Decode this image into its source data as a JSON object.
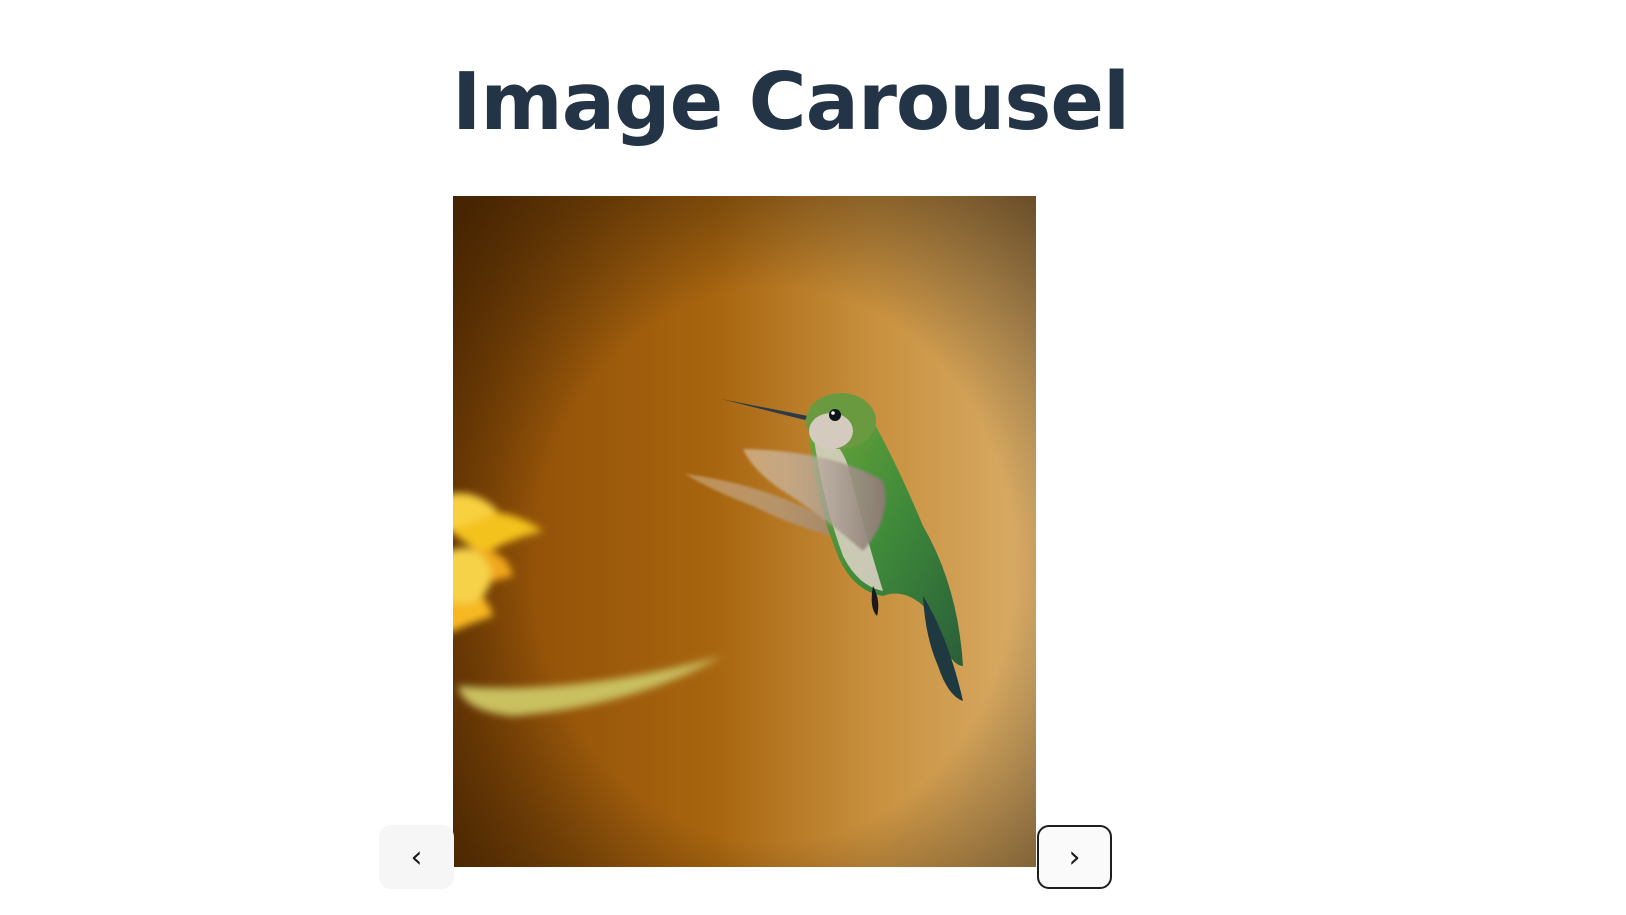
{
  "page": {
    "title": "Image Carousel"
  },
  "carousel": {
    "image_subject": "hummingbird-photo",
    "prev_label": "‹",
    "next_label": "›"
  },
  "colors": {
    "title": "#243447",
    "image_background": "#a8650f",
    "button_border": "#1e1e1e"
  }
}
